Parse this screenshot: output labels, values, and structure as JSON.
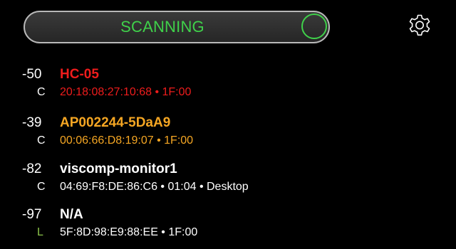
{
  "scan": {
    "label": "SCANNING",
    "color": "#3fd14a"
  },
  "settings": {
    "icon": "gear-icon"
  },
  "devices": [
    {
      "rssi": "-50",
      "name": "HC-05",
      "type": "C",
      "detail": "20:18:08:27:10:68 • 1F:00",
      "color": "#ee1c1c",
      "type_color": "#ffffff"
    },
    {
      "rssi": "-39",
      "name": "AP002244-5DaA9",
      "type": "C",
      "detail": "00:06:66:D8:19:07 • 1F:00",
      "color": "#f5a623",
      "type_color": "#ffffff"
    },
    {
      "rssi": "-82",
      "name": "viscomp-monitor1",
      "type": "C",
      "detail": "04:69:F8:DE:86:C6 • 01:04 • Desktop",
      "color": "#ffffff",
      "type_color": "#ffffff"
    },
    {
      "rssi": "-97",
      "name": "N/A",
      "type": "L",
      "detail": "5F:8D:98:E9:88:EE • 1F:00",
      "color": "#ffffff",
      "type_color": "#8bc34a"
    }
  ]
}
